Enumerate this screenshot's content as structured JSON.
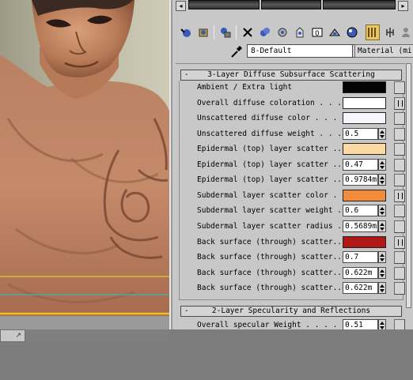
{
  "material": {
    "name": "8-Default",
    "type": "Material (mi)"
  },
  "rollouts": [
    {
      "title": "3-Layer Diffuse Subsurface Scattering",
      "toggle": "-"
    },
    {
      "title": "2-Layer Specularity and Reflections",
      "toggle": "-"
    }
  ],
  "params": [
    {
      "label": "Ambient / Extra light",
      "kind": "color",
      "color": "#050505",
      "map": false
    },
    {
      "label": "Overall diffuse coloration . . . .",
      "kind": "color",
      "color": "#ffffff",
      "map": true
    },
    {
      "label": "Unscattered diffuse color . . . .",
      "kind": "color",
      "color": "#f5f5fc",
      "map": false
    },
    {
      "label": "Unscattered diffuse weight . . .",
      "kind": "spinner",
      "value": "0.5",
      "map": false
    },
    {
      "label": "Epidermal (top) layer scatter ...",
      "kind": "color",
      "color": "#fbd9a0",
      "map": false
    },
    {
      "label": "Epidermal (top) layer scatter ..",
      "kind": "spinner",
      "value": "0.47",
      "map": false
    },
    {
      "label": "Epidermal (top) layer scatter ..",
      "kind": "spinner",
      "value": "0.9784m",
      "map": false
    },
    {
      "label": "Subdermal layer scatter color . .",
      "kind": "color",
      "color": "#f08c3c",
      "map": true
    },
    {
      "label": "Subdermal layer scatter weight  .",
      "kind": "spinner",
      "value": "0.6",
      "map": false
    },
    {
      "label": "Subdermal layer scatter radius .",
      "kind": "spinner",
      "value": "0.5689m",
      "map": false
    },
    {
      "label": "Back surface (through) scatter...",
      "kind": "color",
      "color": "#b01818",
      "map": true
    },
    {
      "label": "Back surface (through) scatter...",
      "kind": "spinner",
      "value": "0.7",
      "map": false
    },
    {
      "label": "Back surface (through) scatter...",
      "kind": "spinner",
      "value": "0.622m",
      "map": false
    },
    {
      "label": "Back surface (through) scatter...",
      "kind": "spinner",
      "value": "0.622m",
      "map": false
    }
  ],
  "specular_params": [
    {
      "label": "Overall specular Weight . . . .",
      "kind": "spinner",
      "value": "0.51",
      "map": false
    }
  ],
  "status": {
    "mark": "↗"
  },
  "toolbar_icons": [
    "get-material-icon",
    "put-material-icon",
    "assign-material-icon",
    "reset-map-icon",
    "copy-material-icon",
    "make-unique-icon",
    "put-library-icon",
    "material-id-icon",
    "show-map-icon",
    "show-end-result-icon",
    "go-parent-icon",
    "go-sibling-icon"
  ]
}
